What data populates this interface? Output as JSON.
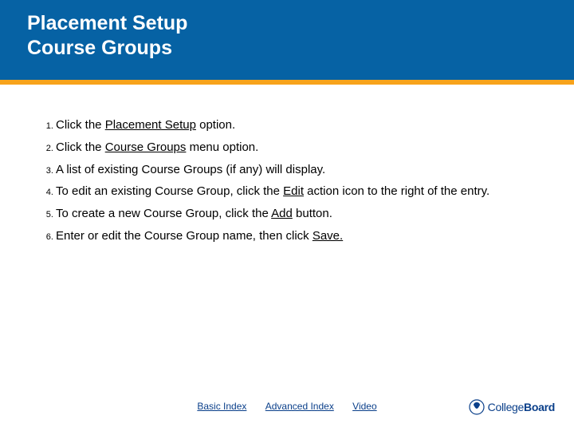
{
  "header": {
    "title_line1": "Placement Setup",
    "title_line2": "Course Groups"
  },
  "steps": [
    {
      "pre": "Click the ",
      "u": "Placement Setup",
      "post": " option."
    },
    {
      "pre": "Click the ",
      "u": "Course Groups",
      "post": " menu option."
    },
    {
      "pre": "A list of existing Course Groups (if any) will display.",
      "u": "",
      "post": ""
    },
    {
      "pre": "To edit an existing Course Group, click the ",
      "u": "Edit",
      "post": " action icon to the right of the entry."
    },
    {
      "pre": "To create a new Course Group, click the ",
      "u": "Add",
      "post": " button."
    },
    {
      "pre": "Enter or edit the Course Group name, then click ",
      "u": "Save.",
      "post": ""
    }
  ],
  "footer": {
    "links": [
      "Basic Index",
      "Advanced Index",
      "Video"
    ]
  },
  "brand": {
    "name_light": "College",
    "name_bold": "Board"
  }
}
